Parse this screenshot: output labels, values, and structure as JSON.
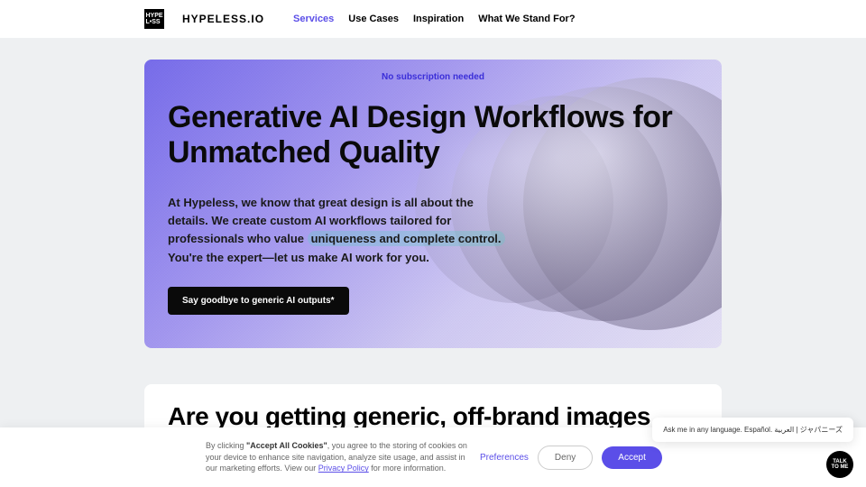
{
  "header": {
    "logo_text": "HYPE\nLESS",
    "brand": "HYPELESS.IO",
    "nav": [
      {
        "label": "Services",
        "active": true
      },
      {
        "label": "Use Cases",
        "active": false
      },
      {
        "label": "Inspiration",
        "active": false
      },
      {
        "label": "What We Stand For?",
        "active": false
      }
    ]
  },
  "hero": {
    "badge": "No subscription needed",
    "title": "Generative AI Design Workflows for Unmatched Quality",
    "desc_1": "At Hypeless, we know that great design is all about the details. We create custom AI workflows tailored for professionals who value ",
    "desc_highlight": "uniqueness and complete control.",
    "desc_2": " You're the expert—let us make AI work for you.",
    "cta": "Say goodbye to generic AI outputs*"
  },
  "section2": {
    "title": "Are you getting generic, off-brand images and"
  },
  "cookies": {
    "text_1": "By clicking ",
    "text_bold": "\"Accept All Cookies\"",
    "text_2": ", you agree to the storing of cookies on your device to enhance site navigation, analyze site usage, and assist in our marketing efforts. View our ",
    "link": "Privacy Policy",
    "text_3": " for more information.",
    "preferences": "Preferences",
    "deny": "Deny",
    "accept": "Accept"
  },
  "chat": {
    "prompt": "Ask me in any language. Español. العربية | ジャパニーズ",
    "fab": "TALK\nTO ME"
  }
}
